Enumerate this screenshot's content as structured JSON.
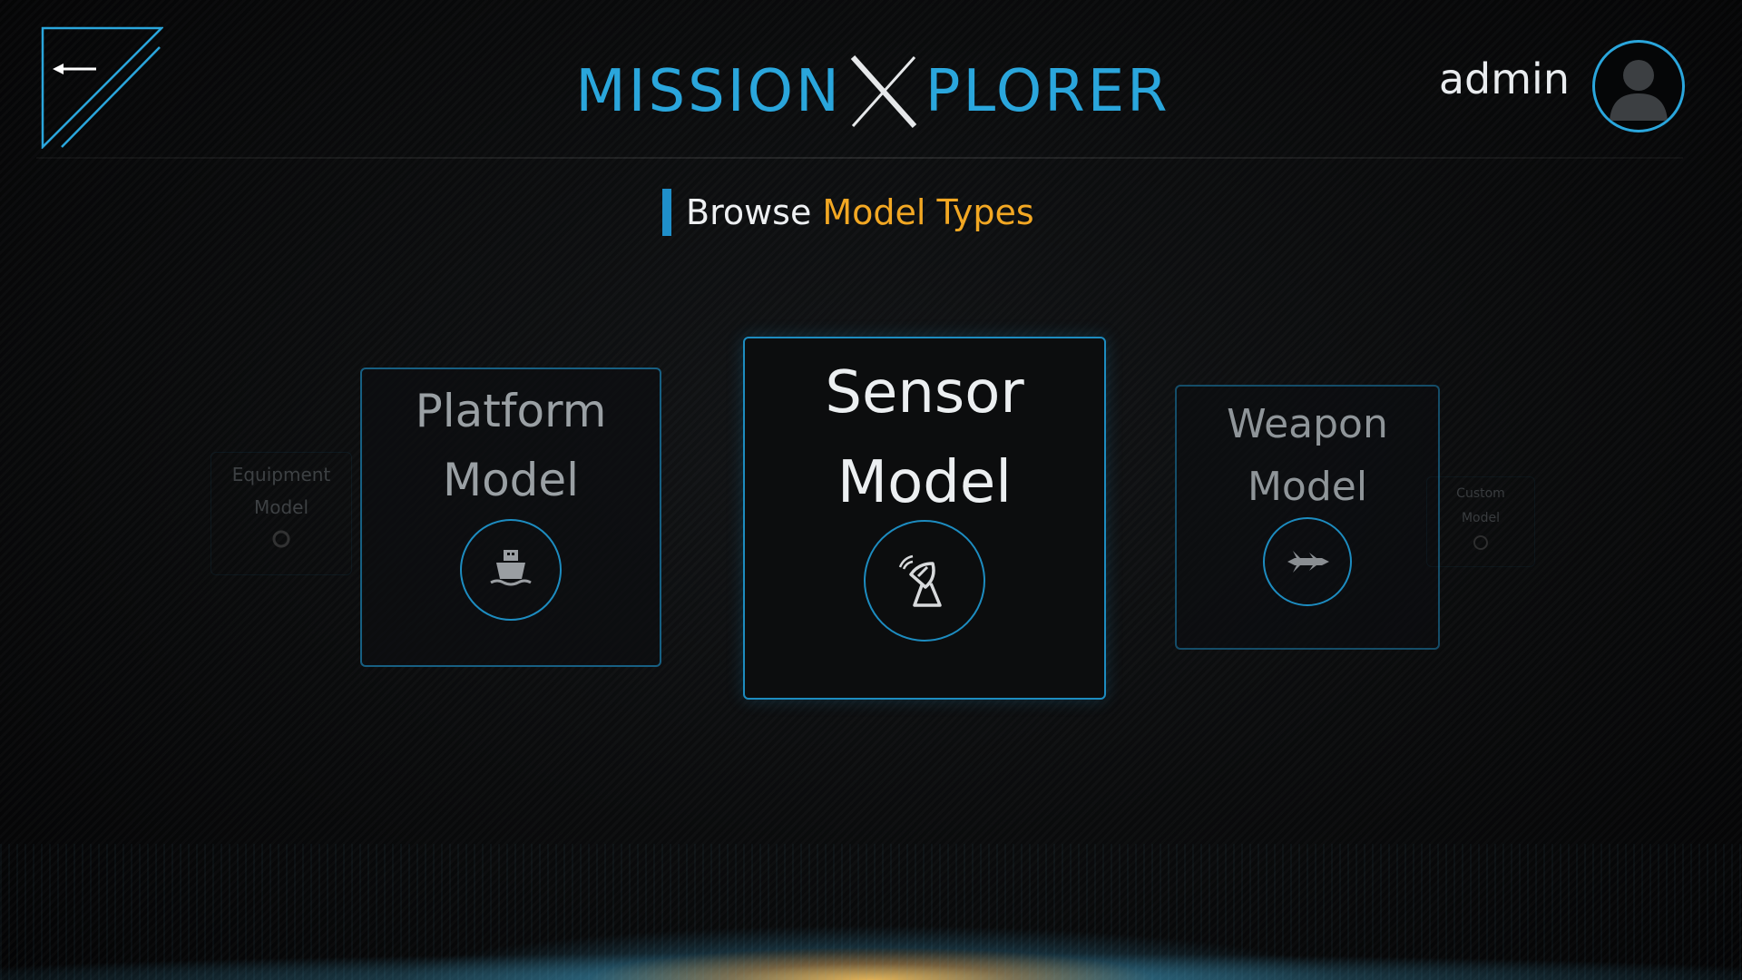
{
  "header": {
    "back_icon": "arrow-left-icon",
    "brand": {
      "left": "MISSION",
      "right": "PLORER"
    },
    "user": {
      "name": "admin",
      "avatar_icon": "user-silhouette-icon"
    }
  },
  "section": {
    "title_prefix": "Browse",
    "title_highlight": "Model Types"
  },
  "cards": [
    {
      "line1": "Equipment",
      "line2": "Model",
      "icon": "equipment-icon",
      "state": "ghost"
    },
    {
      "line1": "Platform",
      "line2": "Model",
      "icon": "ship-icon",
      "state": "side"
    },
    {
      "line1": "Sensor",
      "line2": "Model",
      "icon": "satellite-dish-icon",
      "state": "selected"
    },
    {
      "line1": "Weapon",
      "line2": "Model",
      "icon": "missile-icon",
      "state": "side"
    },
    {
      "line1": "Custom",
      "line2": "Model",
      "icon": "custom-icon",
      "state": "ghost"
    }
  ],
  "colors": {
    "accent_blue": "#2aa6dc",
    "accent_orange": "#f3a823",
    "background": "#060708"
  }
}
